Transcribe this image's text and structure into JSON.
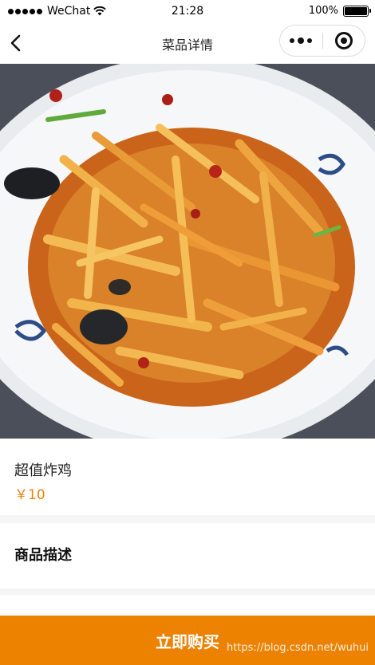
{
  "status_bar": {
    "carrier": "WeChat",
    "time": "21:28",
    "battery": "100%"
  },
  "nav": {
    "title": "菜品详情"
  },
  "product": {
    "name": "超值炸鸡",
    "price": "￥10",
    "image_icon": "food-photo"
  },
  "description": {
    "title": "商品描述"
  },
  "actions": {
    "buy_label": "立即购买"
  },
  "watermark": "https://blog.csdn.net/wuhui",
  "colors": {
    "accent": "#ec8200",
    "price": "#e8830c"
  }
}
